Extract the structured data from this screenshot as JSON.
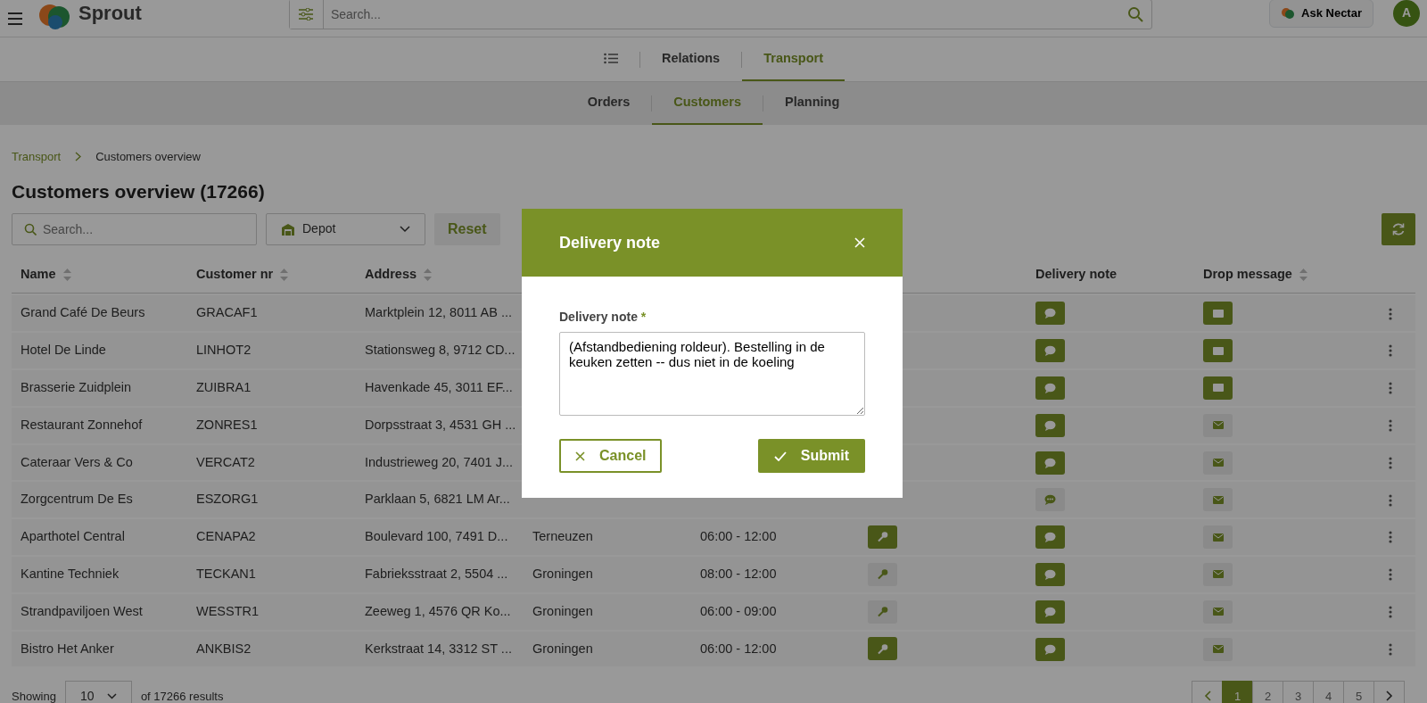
{
  "app": {
    "logo_text": "Sprout",
    "search_placeholder": "Search...",
    "ask_button": "Ask Nectar",
    "avatar": "A"
  },
  "main_nav": [
    {
      "label": "Relations",
      "selected": false
    },
    {
      "label": "Transport",
      "selected": true
    }
  ],
  "sub_nav": [
    {
      "label": "Orders",
      "selected": false
    },
    {
      "label": "Customers",
      "selected": true
    },
    {
      "label": "Planning",
      "selected": false
    }
  ],
  "breadcrumb": [
    {
      "label": "Transport",
      "link": true
    },
    {
      "label": "Customers overview",
      "link": false
    }
  ],
  "page_title": "Customers overview (17266)",
  "filters": {
    "search_placeholder": "Search...",
    "depot": "Depot",
    "reset": "Reset"
  },
  "table": {
    "columns": [
      {
        "label": "Name",
        "sortable": true
      },
      {
        "label": "Customer nr",
        "sortable": true
      },
      {
        "label": "Address",
        "sortable": true
      },
      {},
      {},
      {},
      {
        "label": "Delivery note",
        "sortable": false
      },
      {
        "label": "Drop message",
        "sortable": true
      }
    ],
    "rows": [
      {
        "name": "Grand Café De Beurs",
        "customer_nr": "GRACAF1",
        "address": "Marktplein 12, 8011 AB ...",
        "note_active": true,
        "message_active": true
      },
      {
        "name": "Hotel De Linde",
        "customer_nr": "LINHOT2",
        "address": "Stationsweg 8, 9712 CD...",
        "note_active": true,
        "message_active": true
      },
      {
        "name": "Brasserie Zuidplein",
        "customer_nr": "ZUIBRA1",
        "address": "Havenkade 45, 3011 EF...",
        "note_active": true,
        "message_active": true
      },
      {
        "name": "Restaurant Zonnehof",
        "customer_nr": "ZONRES1",
        "address": "Dorpsstraat 3, 4531 GH ...",
        "note_active": true,
        "message_active": false
      },
      {
        "name": "Cateraar Vers & Co",
        "customer_nr": "VERCAT2",
        "address": "Industrieweg 20, 7401 J...",
        "note_active": true,
        "message_active": false
      },
      {
        "name": "Zorgcentrum De Es",
        "customer_nr": "ESZORG1",
        "address": "Parklaan 5, 6821 LM Ar...",
        "note_active": false,
        "message_active": false
      },
      {
        "name": "Aparthotel Central",
        "customer_nr": "CENAPA2",
        "address": "Boulevard 100, 7491 D...",
        "depot": "Terneuzen",
        "time": "06:00 - 12:00",
        "key_active": true,
        "note_active": true,
        "message_active": false
      },
      {
        "name": "Kantine Techniek",
        "customer_nr": "TECKAN1",
        "address": "Fabrieksstraat 2, 5504 ...",
        "depot": "Groningen",
        "time": "08:00 - 12:00",
        "key_active": false,
        "note_active": true,
        "message_active": false
      },
      {
        "name": "Strandpaviljoen West",
        "customer_nr": "WESSTR1",
        "address": "Zeeweg 1, 4576 QR Ko...",
        "depot": "Groningen",
        "time": "06:00 - 09:00",
        "key_active": false,
        "note_active": true,
        "message_active": false
      },
      {
        "name": "Bistro Het Anker",
        "customer_nr": "ANKBIS2",
        "address": "Kerkstraat 14, 3312 ST ...",
        "depot": "Groningen",
        "time": "06:00 - 12:00",
        "key_active": true,
        "note_active": true,
        "message_active": false
      }
    ]
  },
  "footer": {
    "showing": "Showing",
    "page_size": "10",
    "results": "of 17266 results",
    "pages": [
      {
        "label": "1",
        "selected": true
      },
      {
        "label": "2",
        "selected": false
      },
      {
        "label": "3",
        "selected": false
      },
      {
        "label": "4",
        "selected": false
      },
      {
        "label": "5",
        "selected": false
      }
    ]
  },
  "modal": {
    "title": "Delivery note",
    "field_label": "Delivery note",
    "required_mark": "*",
    "value": "(Afstandbediening roldeur). Bestelling in de keuken zetten -- dus niet in de koeling",
    "cancel": "Cancel",
    "submit": "Submit"
  }
}
